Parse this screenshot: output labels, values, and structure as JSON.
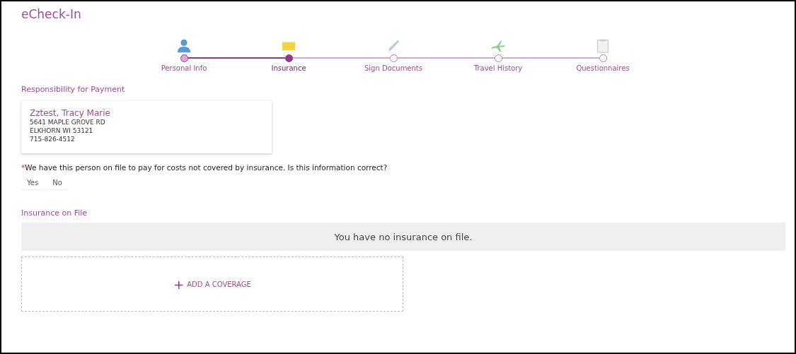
{
  "title": "eCheck-In",
  "steps": [
    {
      "label": "Personal Info",
      "completed": true,
      "selected": false
    },
    {
      "label": "Insurance",
      "completed": false,
      "selected": true
    },
    {
      "label": "Sign Documents",
      "completed": false,
      "selected": false
    },
    {
      "label": "Travel History",
      "completed": false,
      "selected": false
    },
    {
      "label": "Questionnaires",
      "completed": false,
      "selected": false
    }
  ],
  "payment": {
    "heading": "Responsibility for Payment",
    "name": "Zztest, Tracy Marie",
    "address_lines": [
      "5641 MAPLE GROVE RD",
      "ELKHORN WI 53121",
      "715-826-4512"
    ],
    "required_mark": "*",
    "question": "We have this person on file to pay for costs not covered by insurance. Is this information correct?",
    "answers": [
      {
        "label": "Yes",
        "selected": false
      },
      {
        "label": "No",
        "selected": false
      }
    ]
  },
  "insurance": {
    "heading": "Insurance on File",
    "empty_message": "You have no insurance on file.",
    "add_icon": "+",
    "add_label": "ADD A COVERAGE"
  }
}
